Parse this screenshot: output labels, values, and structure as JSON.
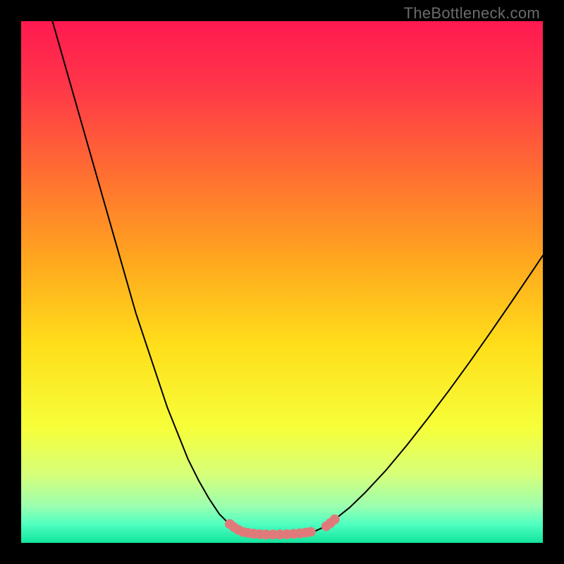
{
  "watermark": "TheBottleneck.com",
  "chart_data": {
    "type": "line",
    "title": "",
    "xlabel": "",
    "ylabel": "",
    "xlim": [
      0,
      100
    ],
    "ylim": [
      0,
      100
    ],
    "grid": false,
    "legend": false,
    "background_gradient": {
      "type": "vertical",
      "stops": [
        {
          "offset": 0.0,
          "color": "#ff1a50"
        },
        {
          "offset": 0.12,
          "color": "#ff3549"
        },
        {
          "offset": 0.28,
          "color": "#ff6a33"
        },
        {
          "offset": 0.45,
          "color": "#ffa41f"
        },
        {
          "offset": 0.62,
          "color": "#ffde1a"
        },
        {
          "offset": 0.78,
          "color": "#f6ff3a"
        },
        {
          "offset": 0.87,
          "color": "#d6ff7a"
        },
        {
          "offset": 0.93,
          "color": "#9bffb0"
        },
        {
          "offset": 0.965,
          "color": "#4dffc0"
        },
        {
          "offset": 1.0,
          "color": "#12e49c"
        }
      ]
    },
    "series": [
      {
        "name": "curve-left",
        "color": "#000000",
        "stroke_width": 2,
        "x": [
          6,
          8,
          10,
          12,
          14,
          16,
          18,
          20,
          22,
          24,
          26,
          28,
          30,
          32,
          34,
          36,
          38,
          40,
          41,
          42,
          43
        ],
        "y": [
          100,
          93,
          86,
          79,
          72,
          65,
          58,
          51,
          44,
          38,
          32,
          26,
          21,
          16,
          12,
          8.5,
          5.5,
          3.5,
          2.7,
          2.2,
          2.0
        ]
      },
      {
        "name": "curve-bottom",
        "color": "#000000",
        "stroke_width": 2,
        "x": [
          43,
          45,
          47,
          49,
          51,
          53,
          55,
          56
        ],
        "y": [
          2.0,
          1.7,
          1.6,
          1.6,
          1.6,
          1.7,
          1.9,
          2.1
        ]
      },
      {
        "name": "curve-right",
        "color": "#000000",
        "stroke_width": 2,
        "x": [
          56,
          58,
          60,
          63,
          66,
          70,
          74,
          78,
          82,
          86,
          90,
          94,
          98,
          100
        ],
        "y": [
          2.1,
          3.0,
          4.4,
          6.8,
          9.7,
          14.0,
          18.8,
          23.9,
          29.2,
          34.7,
          40.4,
          46.2,
          52.1,
          55.1
        ]
      }
    ],
    "markers": [
      {
        "name": "bottom-cluster",
        "color": "#e07a7a",
        "radius": 7,
        "points": [
          {
            "x": 40.0,
            "y": 3.6
          },
          {
            "x": 40.8,
            "y": 3.0
          },
          {
            "x": 41.6,
            "y": 2.5
          },
          {
            "x": 42.5,
            "y": 2.1
          },
          {
            "x": 43.5,
            "y": 1.9
          },
          {
            "x": 44.6,
            "y": 1.75
          },
          {
            "x": 45.8,
            "y": 1.65
          },
          {
            "x": 47.0,
            "y": 1.6
          },
          {
            "x": 48.3,
            "y": 1.6
          },
          {
            "x": 49.6,
            "y": 1.6
          },
          {
            "x": 50.9,
            "y": 1.65
          },
          {
            "x": 52.2,
            "y": 1.72
          },
          {
            "x": 53.4,
            "y": 1.82
          },
          {
            "x": 54.5,
            "y": 1.95
          },
          {
            "x": 55.5,
            "y": 2.1
          },
          {
            "x": 58.5,
            "y": 3.2
          },
          {
            "x": 59.3,
            "y": 3.8
          },
          {
            "x": 60.1,
            "y": 4.5
          }
        ]
      }
    ]
  }
}
